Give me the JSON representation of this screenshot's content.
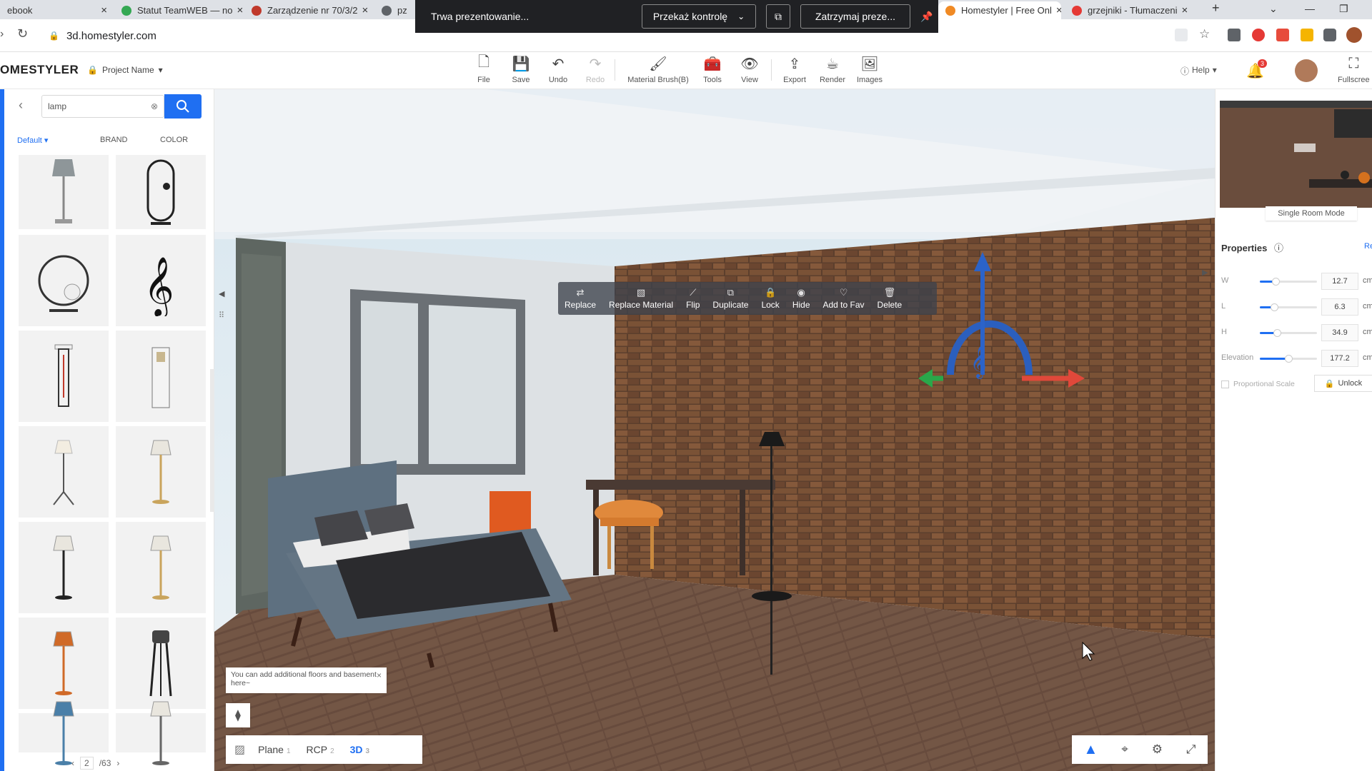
{
  "browser": {
    "tabs": [
      {
        "title": "ebook",
        "favicon_color": "#1877f2"
      },
      {
        "title": "Statut TeamWEB — no",
        "favicon_color": "#34a853"
      },
      {
        "title": "Zarządzenie nr 70/3/2",
        "favicon_color": "#c0392b"
      },
      {
        "title": "pz",
        "favicon_color": "#5f6368"
      },
      {
        "title": "Homestyler | Free Onl",
        "favicon_color": "#f08a24",
        "active": true
      },
      {
        "title": "grzejniki - Tłumaczeni",
        "favicon_color": "#e53935"
      }
    ],
    "new_tab": "+",
    "address": "3d.homestyler.com",
    "presenting": {
      "status": "Trwa prezentowanie...",
      "hand_over": "Przekaż kontrolę",
      "stop": "Zatrzymaj preze..."
    }
  },
  "app": {
    "logo": "OMESTYLER",
    "project_name": "Project Name",
    "toolbar": [
      {
        "label": "File",
        "icon": "file-icon",
        "glyph": "🗋"
      },
      {
        "label": "Save",
        "icon": "save-icon",
        "glyph": "💾"
      },
      {
        "label": "Undo",
        "icon": "undo-icon",
        "glyph": "↶"
      },
      {
        "label": "Redo",
        "icon": "redo-icon",
        "glyph": "↷",
        "disabled": true
      },
      {
        "label": "Material Brush(B)",
        "icon": "brush-icon",
        "glyph": "🖌"
      },
      {
        "label": "Tools",
        "icon": "tools-icon",
        "glyph": "🧰"
      },
      {
        "label": "View",
        "icon": "eye-icon",
        "glyph": "👁"
      },
      {
        "label": "Export",
        "icon": "export-icon",
        "glyph": "⇪"
      },
      {
        "label": "Render",
        "icon": "teapot-icon",
        "glyph": "☕"
      },
      {
        "label": "Images",
        "icon": "images-icon",
        "glyph": "🖼"
      }
    ],
    "help": "Help",
    "notification_count": "3",
    "fullscreen": "Fullscree"
  },
  "catalog": {
    "search_value": "lamp",
    "filters": {
      "default": "Default",
      "brand": "BRAND",
      "color": "COLOR"
    },
    "pager": {
      "page": "2",
      "total": "/63"
    }
  },
  "context_menu": [
    {
      "label": "Replace",
      "glyph": "⇄",
      "icon": "replace-icon"
    },
    {
      "label": "Replace Material",
      "glyph": "▧",
      "icon": "material-icon"
    },
    {
      "label": "Flip",
      "glyph": "⟋",
      "icon": "flip-icon"
    },
    {
      "label": "Duplicate",
      "glyph": "⧉",
      "icon": "duplicate-icon"
    },
    {
      "label": "Lock",
      "glyph": "🔒",
      "icon": "lock-icon"
    },
    {
      "label": "Hide",
      "glyph": "◉",
      "icon": "hide-icon"
    },
    {
      "label": "Add to Fav",
      "glyph": "♡",
      "icon": "heart-icon"
    },
    {
      "label": "Delete",
      "glyph": "🗑",
      "icon": "trash-icon"
    }
  ],
  "tooltip": {
    "text": "You can add additional floors and basement here~"
  },
  "view_tabs": [
    {
      "label": "Plane",
      "key": "1"
    },
    {
      "label": "RCP",
      "key": "2"
    },
    {
      "label": "3D",
      "key": "3",
      "active": true
    }
  ],
  "right": {
    "single_room_mode": "Single Room Mode",
    "properties_title": "Properties",
    "reset": "Re",
    "props": [
      {
        "label": "W",
        "value": "12.7",
        "unit": "cm",
        "level": 0.28
      },
      {
        "label": "L",
        "value": "6.3",
        "unit": "cm",
        "level": 0.25
      },
      {
        "label": "H",
        "value": "34.9",
        "unit": "cm",
        "level": 0.3
      },
      {
        "label": "Elevation",
        "value": "177.2",
        "unit": "cm",
        "level": 0.5
      }
    ],
    "proportional_scale": "Proportional Scale",
    "unlock": "Unlock"
  },
  "colors": {
    "accent": "#1f6ff2",
    "brick": "#6b4a35",
    "floor": "#7a5a48"
  }
}
